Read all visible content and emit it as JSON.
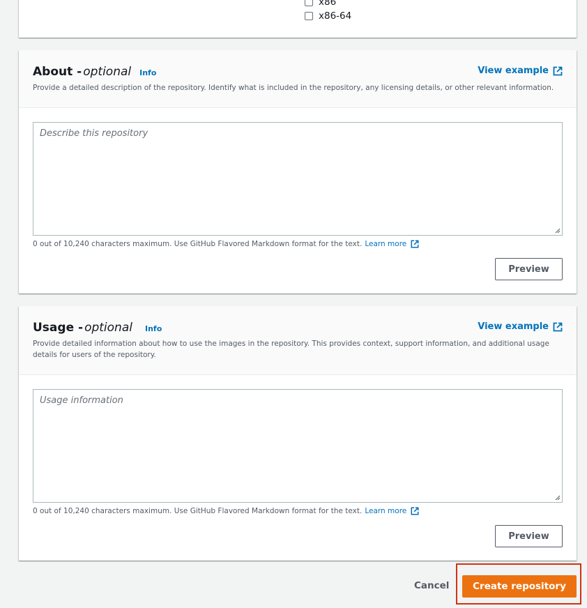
{
  "architectures": {
    "items": [
      {
        "label": "x86",
        "checked": false
      },
      {
        "label": "x86-64",
        "checked": false
      }
    ]
  },
  "about": {
    "title": "About - ",
    "optional": "optional",
    "info": "Info",
    "view_example": "View example",
    "description": "Provide a detailed description of the repository. Identify what is included in the repository, any licensing details, or other relevant information.",
    "placeholder": "Describe this repository",
    "constraint": "0 out of 10,240 characters maximum. Use GitHub Flavored Markdown format for the text.",
    "learn_more": "Learn more",
    "preview": "Preview"
  },
  "usage": {
    "title": "Usage - ",
    "optional": "optional",
    "info": "Info",
    "view_example": "View example",
    "description": "Provide detailed information about how to use the images in the repository. This provides context, support information, and additional usage details for users of the repository.",
    "placeholder": "Usage information",
    "constraint": "0 out of 10,240 characters maximum. Use GitHub Flavored Markdown format for the text.",
    "learn_more": "Learn more",
    "preview": "Preview"
  },
  "actions": {
    "cancel": "Cancel",
    "create": "Create repository"
  },
  "colors": {
    "link": "#0073bb",
    "primary": "#ec7211",
    "highlight": "#d13212"
  }
}
